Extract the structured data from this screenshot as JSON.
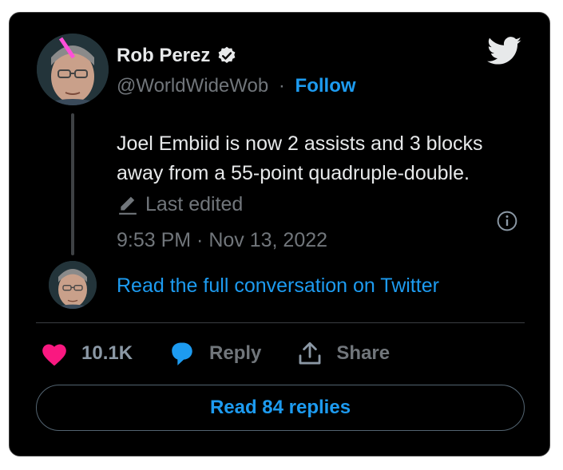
{
  "author": {
    "name": "Rob Perez",
    "handle": "@WorldWideWob",
    "separator": "·",
    "follow_label": "Follow",
    "verified_icon": "verified-badge-icon"
  },
  "tweet": {
    "text": "Joel Embiid is now 2 assists and 3 blocks away from a 55-point quadruple-double.",
    "edited_label": "Last edited",
    "timestamp": "9:53 PM · Nov 13, 2022"
  },
  "thread": {
    "read_conversation_label": "Read the full conversation on Twitter"
  },
  "actions": {
    "like_count": "10.1K",
    "reply_label": "Reply",
    "share_label": "Share"
  },
  "replies_button_label": "Read 84 replies",
  "colors": {
    "background": "#000000",
    "text": "#e7e9ea",
    "muted": "#71767b",
    "accent": "#1d9bf0",
    "like": "#f91880"
  }
}
